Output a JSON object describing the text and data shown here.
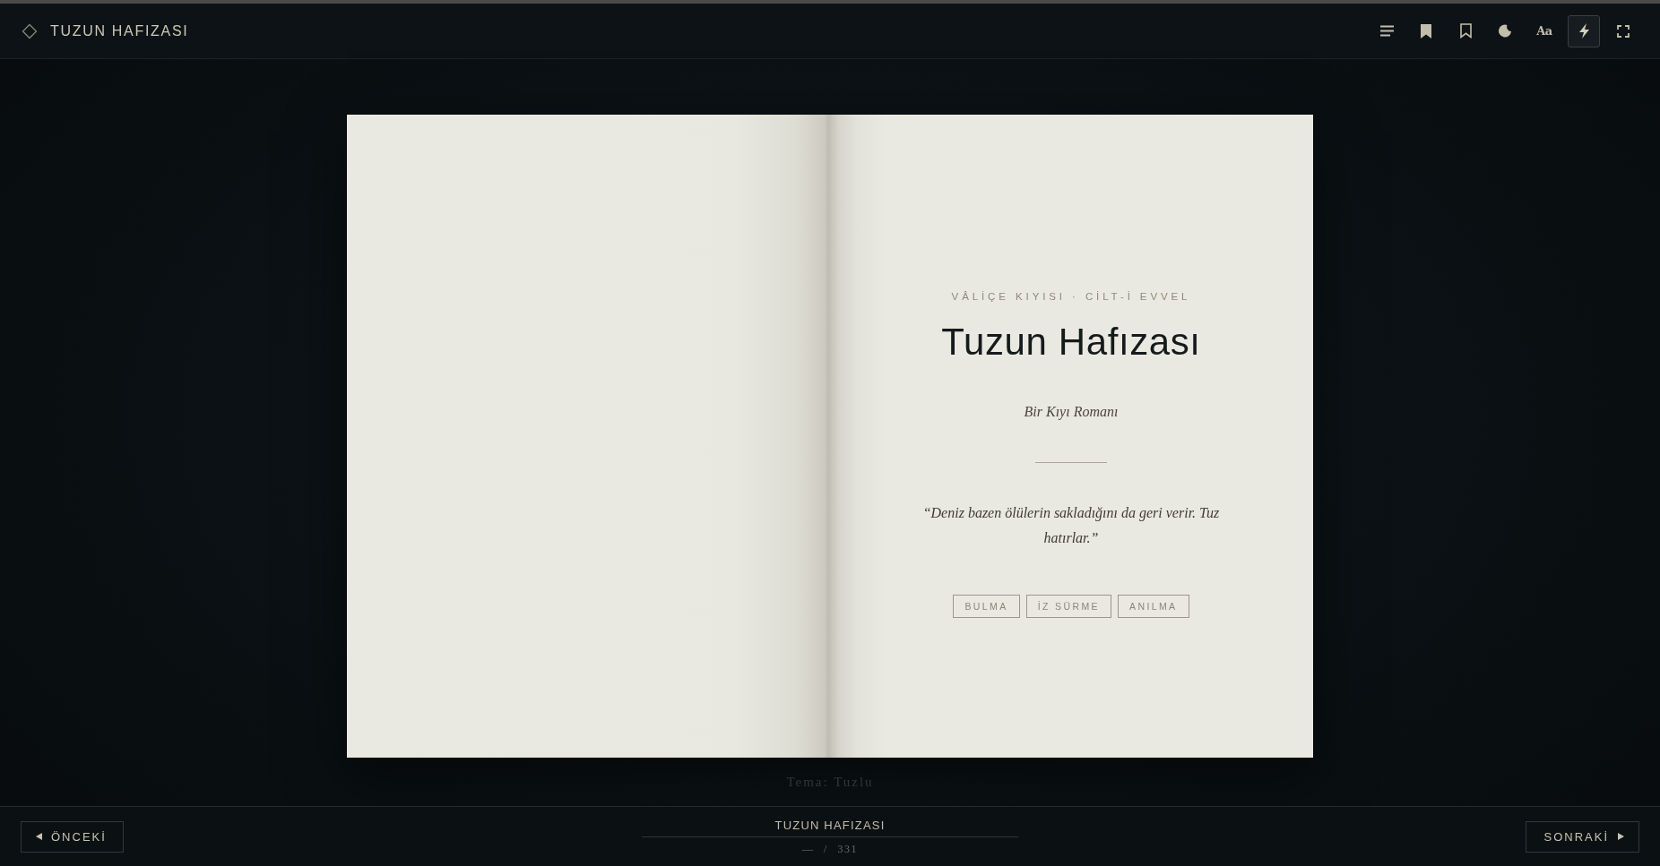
{
  "app_bar": {
    "title": "TUZUN HAFIZASI",
    "tools": [
      {
        "kind": "menu",
        "on": false
      },
      {
        "kind": "bookmark",
        "on": false
      },
      {
        "kind": "bookmark_outline",
        "on": false
      },
      {
        "kind": "moon",
        "on": false
      },
      {
        "kind": "text",
        "label": "Aa",
        "on": false
      },
      {
        "kind": "bolt",
        "on": true
      },
      {
        "kind": "fullscreen",
        "on": false
      }
    ]
  },
  "book": {
    "right_page": {
      "overline": "VÂLİÇE KIYISI · CİLT-İ EVVEL",
      "title": "Tuzun Hafızası",
      "subtitle": "Bir Kıyı Romanı",
      "epigraph": "“Deniz bazen ölülerin sakladığını da geri verir. Tuz hatırlar.”",
      "tags": [
        "BULMA",
        "İZ SÜRME",
        "ANILMA"
      ]
    }
  },
  "toast": "Tema: Tuzlu",
  "footer": {
    "previous": {
      "label": "ÖNCEKİ"
    },
    "book_title": "TUZUN HAFIZASI",
    "page_counter": "— / 331",
    "next": {
      "label": "SONRAKİ"
    }
  }
}
